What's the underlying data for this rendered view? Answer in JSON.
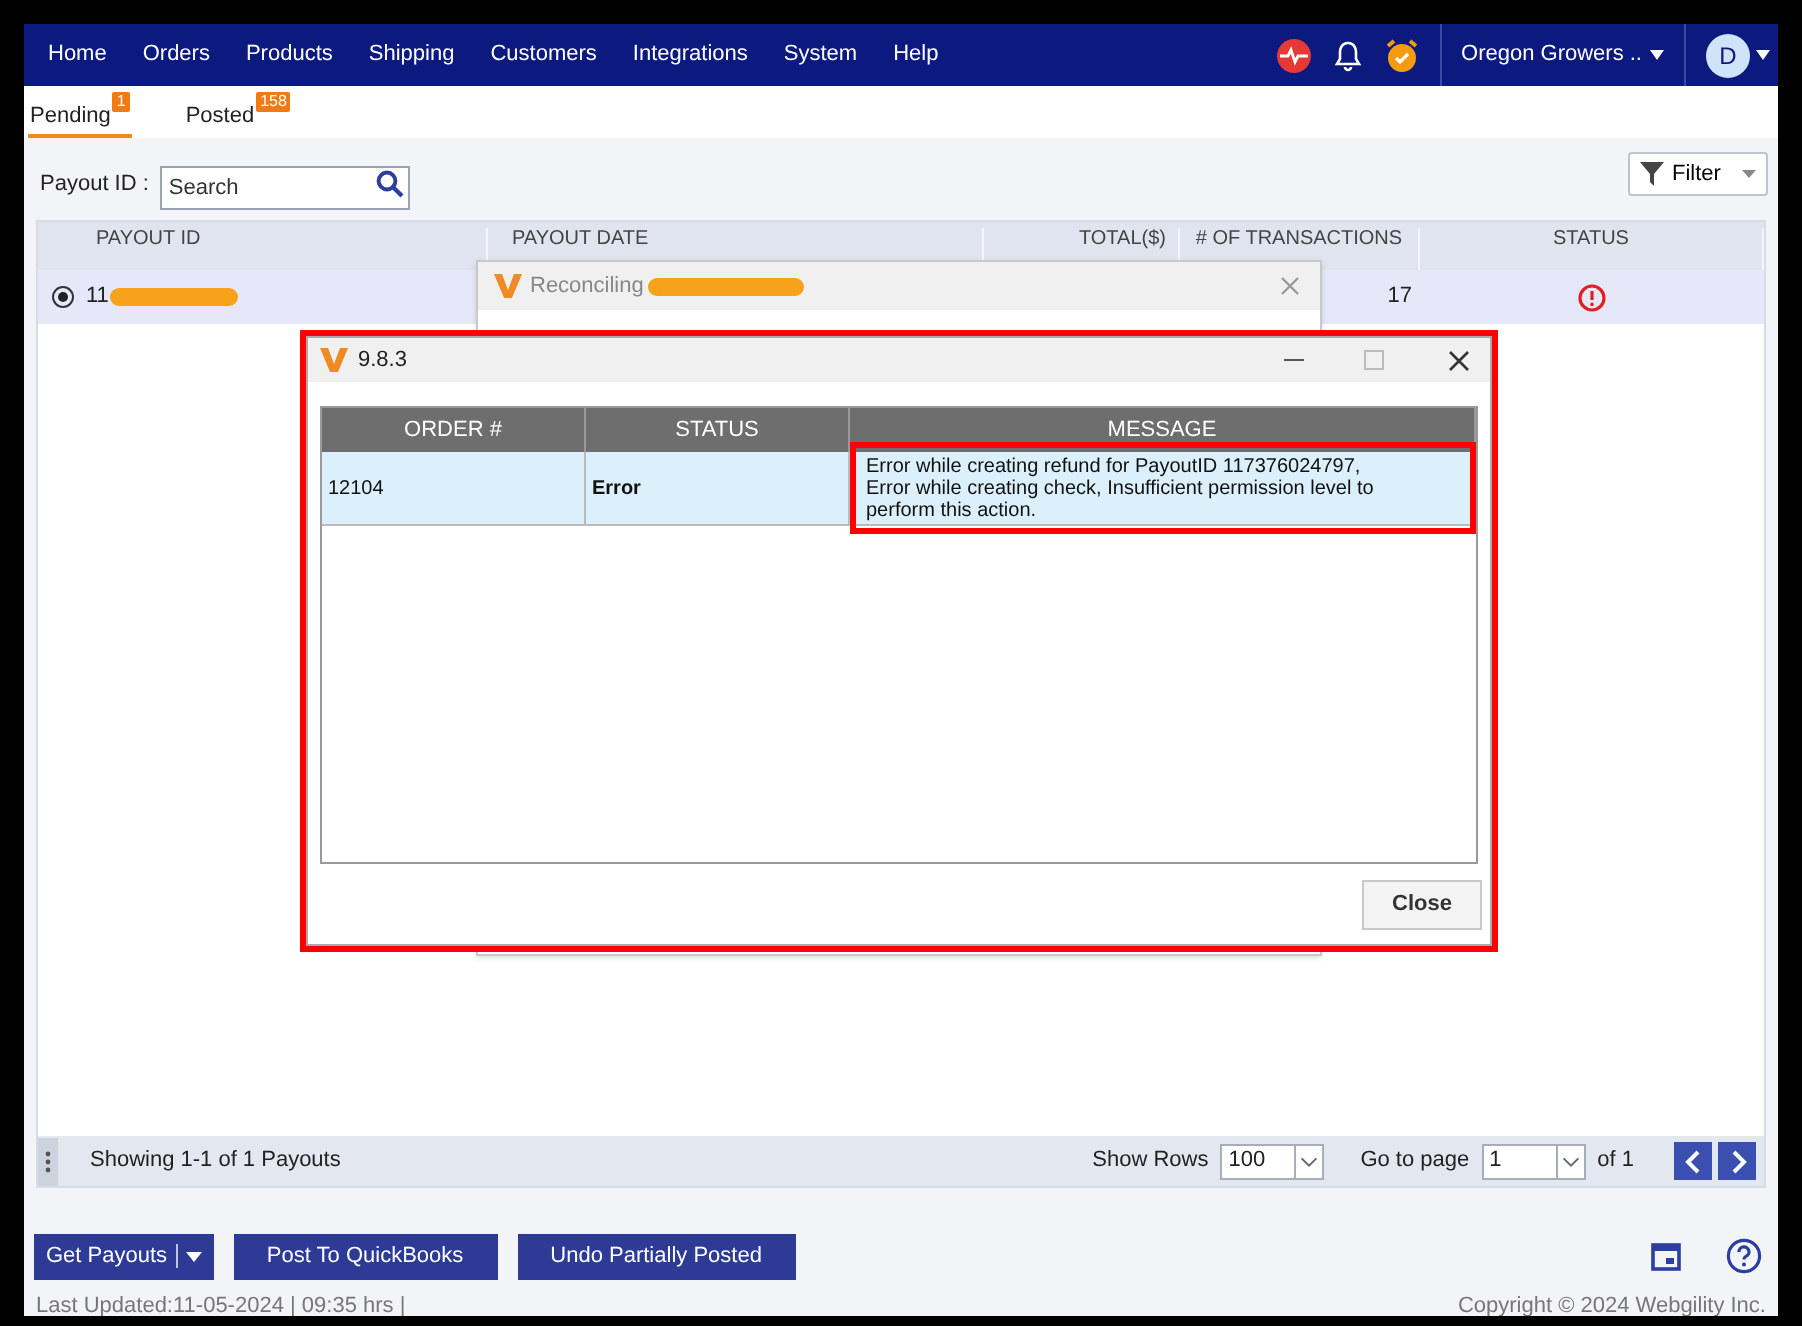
{
  "nav": {
    "items": [
      "Home",
      "Orders",
      "Products",
      "Shipping",
      "Customers",
      "Integrations",
      "System",
      "Help"
    ],
    "account": "Oregon Growers ..",
    "avatar": "D"
  },
  "tabs": [
    {
      "label": "Pending",
      "badge": "1",
      "selected": true
    },
    {
      "label": "Posted",
      "badge": "158",
      "selected": false
    }
  ],
  "search": {
    "label": "Payout ID :",
    "placeholder": "Search"
  },
  "filter": "Filter",
  "table": {
    "columns": [
      "PAYOUT ID",
      "PAYOUT DATE",
      "TOTAL($)",
      "# OF TRANSACTIONS",
      "STATUS"
    ],
    "rows": [
      {
        "payout_id": "11",
        "selected": true,
        "transactions": "17",
        "kind": "error"
      }
    ]
  },
  "pager": {
    "showing": "Showing 1-1 of 1 Payouts",
    "rows_label": "Show Rows",
    "rows": "100",
    "page_label": "Go to page",
    "page": "1",
    "of": "of 1"
  },
  "buttons": [
    "Get Payouts",
    "Post To QuickBooks",
    "Undo Partially Posted"
  ],
  "last_updated": "Last Updated:11-05-2024 | 09:35 hrs |",
  "copyright": "Copyright © 2024 Webgility Inc.",
  "reconciling_dialog": {
    "title": "Reconciling"
  },
  "result_dialog": {
    "title": "9.8.3",
    "columns": [
      "ORDER #",
      "STATUS",
      "MESSAGE"
    ],
    "rows": [
      {
        "order": "12104",
        "status": "Error",
        "message": "Error while creating refund for PayoutID 117376024797, Error while creating check, Insufficient permission level to perform this action."
      }
    ],
    "button": "Close"
  }
}
